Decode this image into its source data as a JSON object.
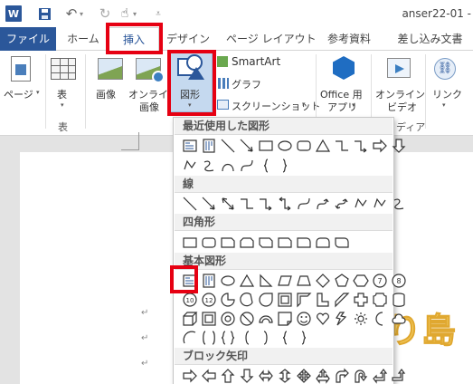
{
  "title_bar": {
    "word_logo": "W",
    "document_title": "anser22-01 -",
    "icons": [
      "word-logo",
      "save-icon",
      "undo-icon",
      "redo-icon",
      "touch-mode-icon",
      "customize-qat-icon"
    ]
  },
  "tabs": [
    {
      "label": "ファイル"
    },
    {
      "label": "ホーム"
    },
    {
      "label": "挿入"
    },
    {
      "label": "デザイン"
    },
    {
      "label": "ページ レイアウト"
    },
    {
      "label": "参考資料"
    },
    {
      "label": "差し込み文書"
    }
  ],
  "ribbon": {
    "pages_label": "ページ",
    "table_label": "表",
    "table_group": "表",
    "picture_label": "画像",
    "online_picture_label_1": "オンライン",
    "online_picture_label_2": "画像",
    "shapes_label": "図形",
    "smartart_label": "SmartArt",
    "chart_label": "グラフ",
    "screenshot_label": "スクリーンショット",
    "office_apps_label_1": "Office 用",
    "office_apps_label_2": "アプリ",
    "online_video_label_1": "オンライン",
    "online_video_label_2": "ビデオ",
    "media_group": "ディア",
    "link_label": "リンク"
  },
  "gallery": {
    "categories": {
      "recent": "最近使用した図形",
      "lines": "線",
      "rectangles": "四角形",
      "basic": "基本図形",
      "block_arrows": "ブロック矢印"
    }
  },
  "document": {
    "paragraph_mark": "↵",
    "wordart_text": "り島"
  },
  "highlight_color": "#e60012",
  "accent_color": "#2b579a"
}
